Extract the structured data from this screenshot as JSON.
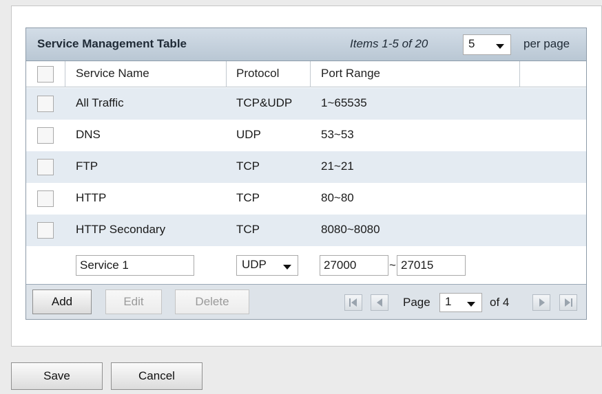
{
  "table": {
    "title": "Service Management Table",
    "items_info": "Items 1-5 of 20",
    "per_page_value": "5",
    "per_page_label": "per page",
    "columns": [
      "Service Name",
      "Protocol",
      "Port Range"
    ],
    "rows": [
      {
        "name": "All Traffic",
        "protocol": "TCP&UDP",
        "port_range": "1~65535"
      },
      {
        "name": "DNS",
        "protocol": "UDP",
        "port_range": "53~53"
      },
      {
        "name": "FTP",
        "protocol": "TCP",
        "port_range": "21~21"
      },
      {
        "name": "HTTP",
        "protocol": "TCP",
        "port_range": "80~80"
      },
      {
        "name": "HTTP Secondary",
        "protocol": "TCP",
        "port_range": "8080~8080"
      }
    ],
    "new_row": {
      "service_name": "Service 1",
      "protocol": "UDP",
      "port_start": "27000",
      "port_separator": "~",
      "port_end": "27015"
    }
  },
  "footer": {
    "add_label": "Add",
    "edit_label": "Edit",
    "delete_label": "Delete",
    "page_label": "Page",
    "page_value": "1",
    "of_label": "of 4"
  },
  "actions": {
    "save_label": "Save",
    "cancel_label": "Cancel"
  },
  "colors": {
    "title_bar": "#c6d2de",
    "alt_row": "#e4ebf2",
    "footer_bar": "#dde3e9",
    "page_bg": "#ebebeb"
  },
  "icons": {
    "first_page": "first-page-icon",
    "prev_page": "prev-page-icon",
    "next_page": "next-page-icon",
    "last_page": "last-page-icon",
    "dropdown": "chevron-down-icon"
  }
}
